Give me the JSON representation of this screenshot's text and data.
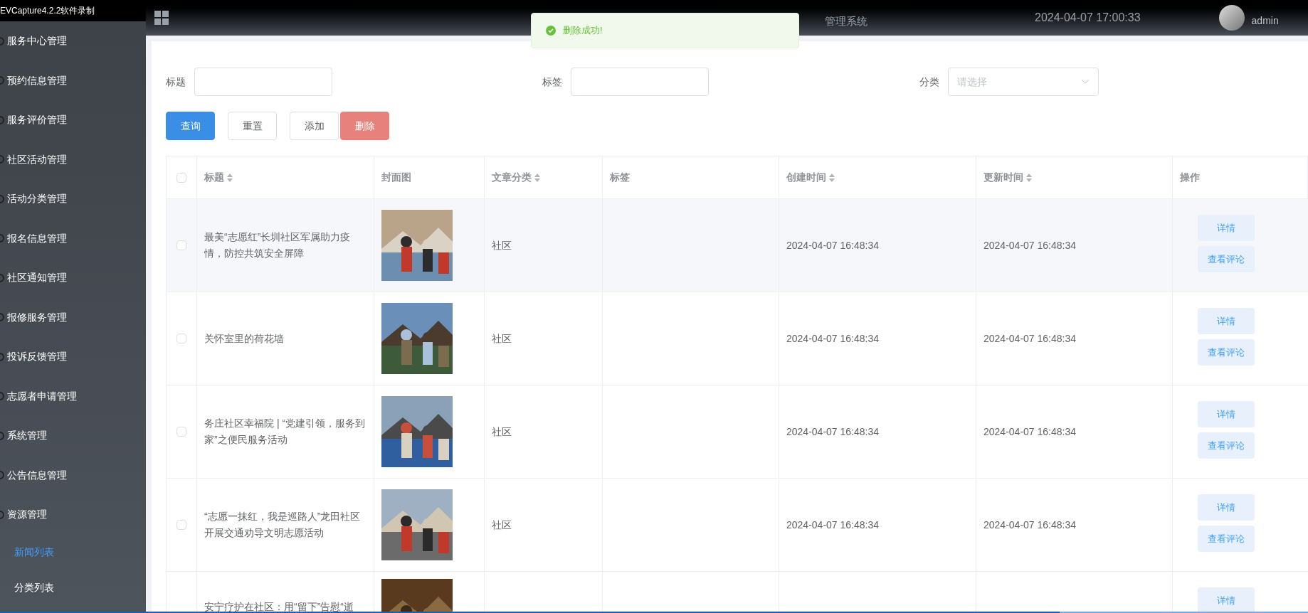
{
  "recorder_label": "EVCapture4.2.2软件录制",
  "header": {
    "title": "管理系统",
    "datetime": "2024-04-07 17:00:33",
    "user": "admin"
  },
  "toast": {
    "message": "删除成功!"
  },
  "recording_progress": {
    "level": 0.81
  },
  "sidebar": {
    "items": [
      {
        "label": "服务中心管理",
        "selected": false
      },
      {
        "label": "预约信息管理",
        "selected": false
      },
      {
        "label": "服务评价管理",
        "selected": false
      },
      {
        "label": "社区活动管理",
        "selected": false
      },
      {
        "label": "活动分类管理",
        "selected": false
      },
      {
        "label": "报名信息管理",
        "selected": false
      },
      {
        "label": "社区通知管理",
        "selected": false
      },
      {
        "label": "报修服务管理",
        "selected": false
      },
      {
        "label": "投诉反馈管理",
        "selected": false
      },
      {
        "label": "志愿者申请管理",
        "selected": false
      },
      {
        "label": "系统管理",
        "selected": false
      },
      {
        "label": "公告信息管理",
        "selected": false
      },
      {
        "label": "资源管理",
        "selected": false,
        "children": [
          {
            "label": "新闻列表",
            "selected": true
          },
          {
            "label": "分类列表",
            "selected": false
          }
        ]
      }
    ]
  },
  "filters": [
    {
      "kind": "text",
      "label": "标题"
    },
    {
      "kind": "text",
      "label": "标签"
    },
    {
      "kind": "select",
      "label": "分类",
      "placeholder": "请选择"
    }
  ],
  "buttons": [
    {
      "kind": "primary",
      "label": "查询"
    },
    {
      "kind": "plain",
      "label": "重置"
    },
    {
      "kind": "plain",
      "label": "添加"
    },
    {
      "kind": "danger",
      "label": "删除"
    }
  ],
  "table": {
    "select_all": {
      "checked": false
    },
    "columns": [
      {
        "label": "标题",
        "sortable": true
      },
      {
        "label": "封面图",
        "sortable": false
      },
      {
        "label": "文章分类",
        "sortable": true
      },
      {
        "label": "标签",
        "sortable": false
      },
      {
        "label": "创建时间",
        "sortable": true
      },
      {
        "label": "更新时间",
        "sortable": true
      },
      {
        "label": "操作",
        "sortable": false
      }
    ],
    "rows": [
      {
        "title": "最美“志愿红”长圳社区军属助力疫情，防控共筑安全屏障",
        "category": "社区",
        "created": "2024-04-07 16:48:34",
        "updated": "2024-04-07 16:48:34",
        "checked": false,
        "actions": [
          "详情",
          "查看评论"
        ]
      },
      {
        "title": "关怀室里的荷花墙",
        "category": "社区",
        "created": "2024-04-07 16:48:34",
        "updated": "2024-04-07 16:48:34",
        "checked": false,
        "actions": [
          "详情",
          "查看评论"
        ]
      },
      {
        "title": "务庄社区幸福院 | “党建引领，服务到家”之便民服务活动",
        "category": "社区",
        "created": "2024-04-07 16:48:34",
        "updated": "2024-04-07 16:48:34",
        "checked": false,
        "actions": [
          "详情",
          "查看评论"
        ]
      },
      {
        "title": "“志愿一抹红，我是巡路人”龙田社区开展交通劝导文明志愿活动",
        "category": "社区",
        "created": "2024-04-07 16:48:34",
        "updated": "2024-04-07 16:48:34",
        "checked": false,
        "actions": [
          "详情",
          "查看评论"
        ]
      },
      {
        "title": "安宁疗护在社区：用“留下”告慰“逝",
        "actions": [
          "详情"
        ]
      }
    ]
  }
}
